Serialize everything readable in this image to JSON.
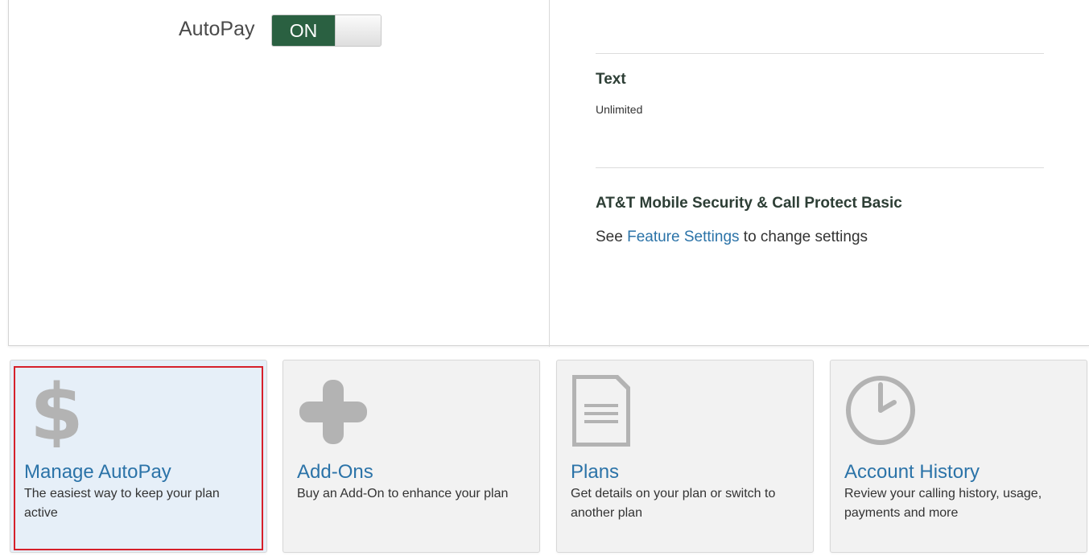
{
  "autopay": {
    "label": "AutoPay",
    "toggle_label": "ON",
    "state": "on"
  },
  "features": [
    {
      "title": "Text",
      "subtitle": "Unlimited"
    },
    {
      "title": "AT&T Mobile Security & Call Protect Basic",
      "pre_link": "See ",
      "link": "Feature Settings",
      "post_link": " to change settings"
    }
  ],
  "cards": [
    {
      "title": "Manage AutoPay",
      "desc": "The easiest way to keep your plan active",
      "icon": "dollar-icon",
      "selected": true
    },
    {
      "title": "Add-Ons",
      "desc": "Buy an Add-On to enhance your plan",
      "icon": "plus-icon"
    },
    {
      "title": "Plans",
      "desc": "Get details on your plan or switch to another plan",
      "icon": "document-icon"
    },
    {
      "title": "Account History",
      "desc": "Review your calling history, usage, payments and more",
      "icon": "clock-icon"
    }
  ],
  "colors": {
    "toggle_on": "#2a6041",
    "link": "#2b73a8",
    "highlight_border": "#d6202a",
    "icon_gray": "#b0b0b0"
  }
}
